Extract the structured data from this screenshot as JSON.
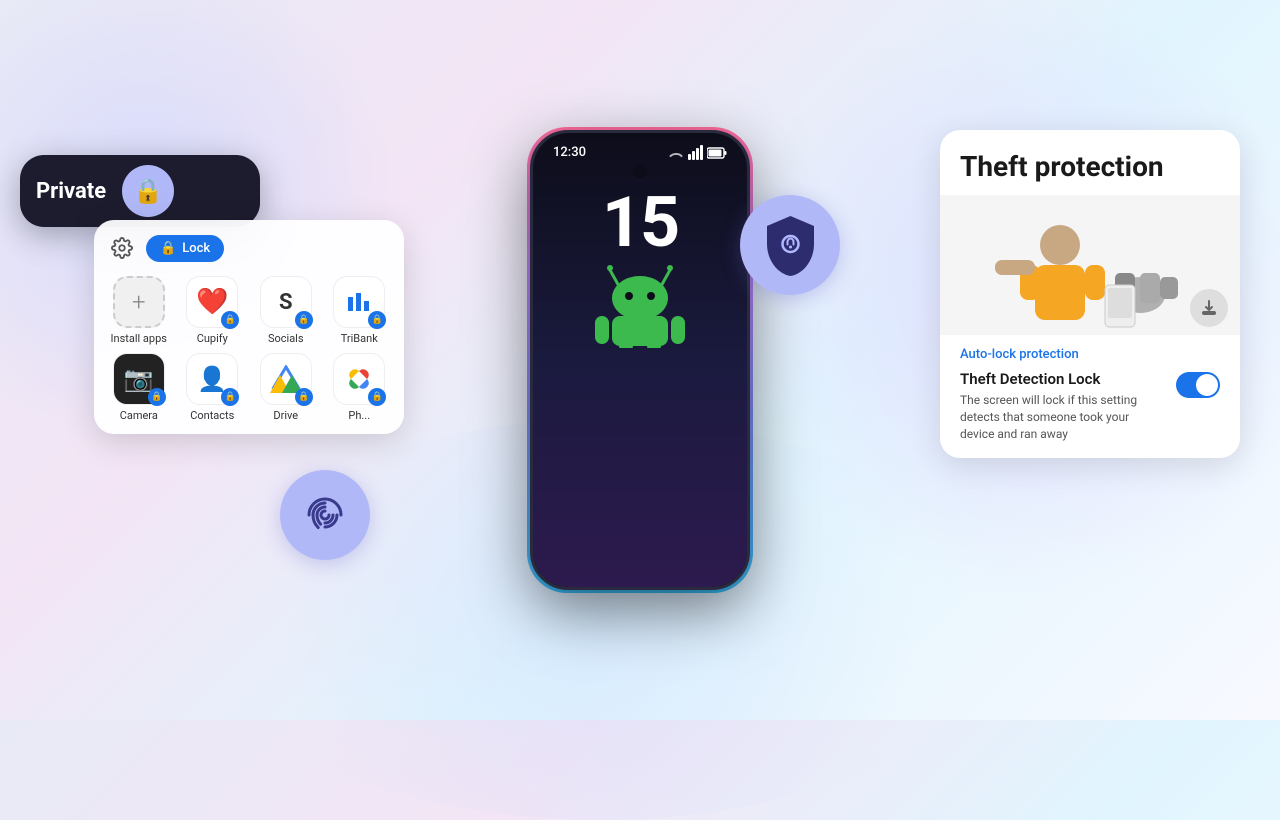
{
  "background": {
    "gradient": "linear-gradient(135deg, #e8eaf6 0%, #f3e5f5 30%, #e1f5fe 60%, #f8f9ff 100%)"
  },
  "phone": {
    "time": "12:30",
    "clock_display": "15"
  },
  "private_space": {
    "label": "Private",
    "lock_button_aria": "Lock private space"
  },
  "app_panel": {
    "lock_button_label": "Lock",
    "apps": [
      {
        "name": "Install apps",
        "icon": "+",
        "has_lock": false,
        "type": "install"
      },
      {
        "name": "Cupify",
        "icon": "❤️",
        "has_lock": true,
        "type": "cupify"
      },
      {
        "name": "Socials",
        "icon": "⬛",
        "has_lock": true,
        "type": "socials"
      },
      {
        "name": "TriBank",
        "icon": "📊",
        "has_lock": true,
        "type": "tribank"
      },
      {
        "name": "Camera",
        "icon": "📷",
        "has_lock": true,
        "type": "camera"
      },
      {
        "name": "Contacts",
        "icon": "👤",
        "has_lock": true,
        "type": "contacts"
      },
      {
        "name": "Drive",
        "icon": "▲",
        "has_lock": true,
        "type": "drive"
      },
      {
        "name": "Ph...",
        "icon": "✿",
        "has_lock": true,
        "type": "photos"
      }
    ]
  },
  "theft_protection": {
    "title": "Theft protection",
    "auto_lock_label": "Auto-lock protection",
    "feature_title": "Theft Detection Lock",
    "feature_description": "The screen will lock if this setting detects that someone took your device and ran away",
    "toggle_enabled": true
  }
}
